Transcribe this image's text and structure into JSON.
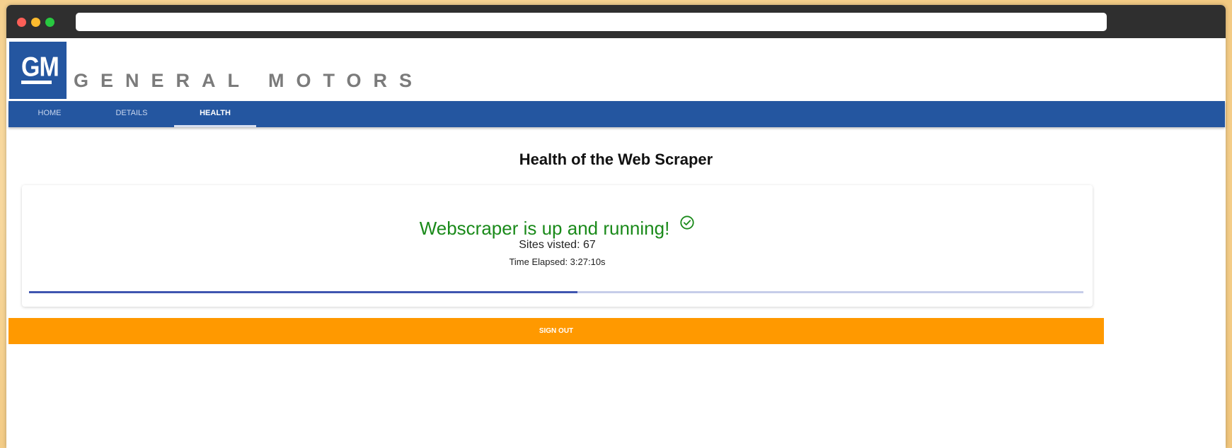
{
  "brand": {
    "logo_text": "GM",
    "wordmark": "GENERAL MOTORS",
    "color": "#2456a0"
  },
  "nav": {
    "tabs": [
      {
        "label": "HOME",
        "active": false
      },
      {
        "label": "DETAILS",
        "active": false
      },
      {
        "label": "HEALTH",
        "active": true
      }
    ]
  },
  "main": {
    "title": "Health of the Web Scraper",
    "status": {
      "message": "Webscraper is up and running!",
      "icon": "check-circle-icon",
      "color": "#1a8a1a",
      "sites_visited": "Sites visted: 67",
      "time_elapsed": "Time Elapsed: 3:27:10s",
      "progress_fraction": 0.52
    }
  },
  "footer": {
    "signout_label": "SIGN OUT",
    "signout_color": "#ff9900"
  }
}
